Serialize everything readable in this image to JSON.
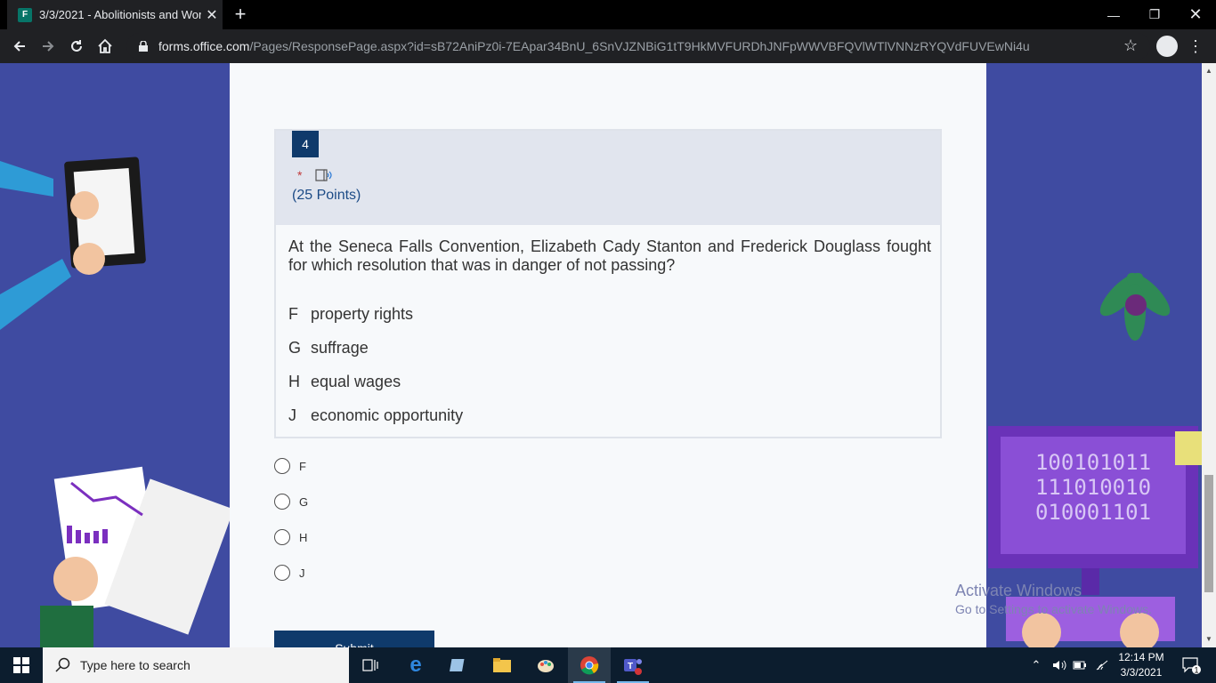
{
  "browser": {
    "tab_title": "3/3/2021 - Abolitionists and Wor",
    "tab_favicon": "forms-icon",
    "url_host": "forms.office.com",
    "url_path": "/Pages/ResponsePage.aspx?id=sB72AniPz0i-7EApar34BnU_6SnVJZNBiG1tT9HkMVFURDhJNFpWWVBFQVlWTlVNNzRYQVdFUVEwNi4u"
  },
  "question": {
    "number": "4",
    "required_mark": "*",
    "points": "(25 Points)",
    "body": "At the Seneca Falls Convention, Elizabeth Cady Stanton and Frederick Douglass fought for which resolution that was in danger of not passing?",
    "options": [
      {
        "letter": "F",
        "text": "property rights"
      },
      {
        "letter": "G",
        "text": "suffrage"
      },
      {
        "letter": "H",
        "text": "equal wages"
      },
      {
        "letter": "J",
        "text": "economic opportunity"
      }
    ],
    "choices": [
      "F",
      "G",
      "H",
      "J"
    ]
  },
  "submit_label": "Submit",
  "watermark": {
    "line1": "Activate Windows",
    "line2": "Go to Settings to activate Windows."
  },
  "decor": {
    "binary_lines": [
      "100101011",
      "111010010",
      "010001101"
    ]
  },
  "taskbar": {
    "search_placeholder": "Type here to search",
    "time": "12:14 PM",
    "date": "3/3/2021",
    "notification_count": "1"
  },
  "colors": {
    "page_bg": "#3f4ba1",
    "card_bg": "#f7f9fb",
    "accent": "#0f3a6b",
    "question_header_bg": "#e1e5ee",
    "required": "#c13a3a"
  }
}
